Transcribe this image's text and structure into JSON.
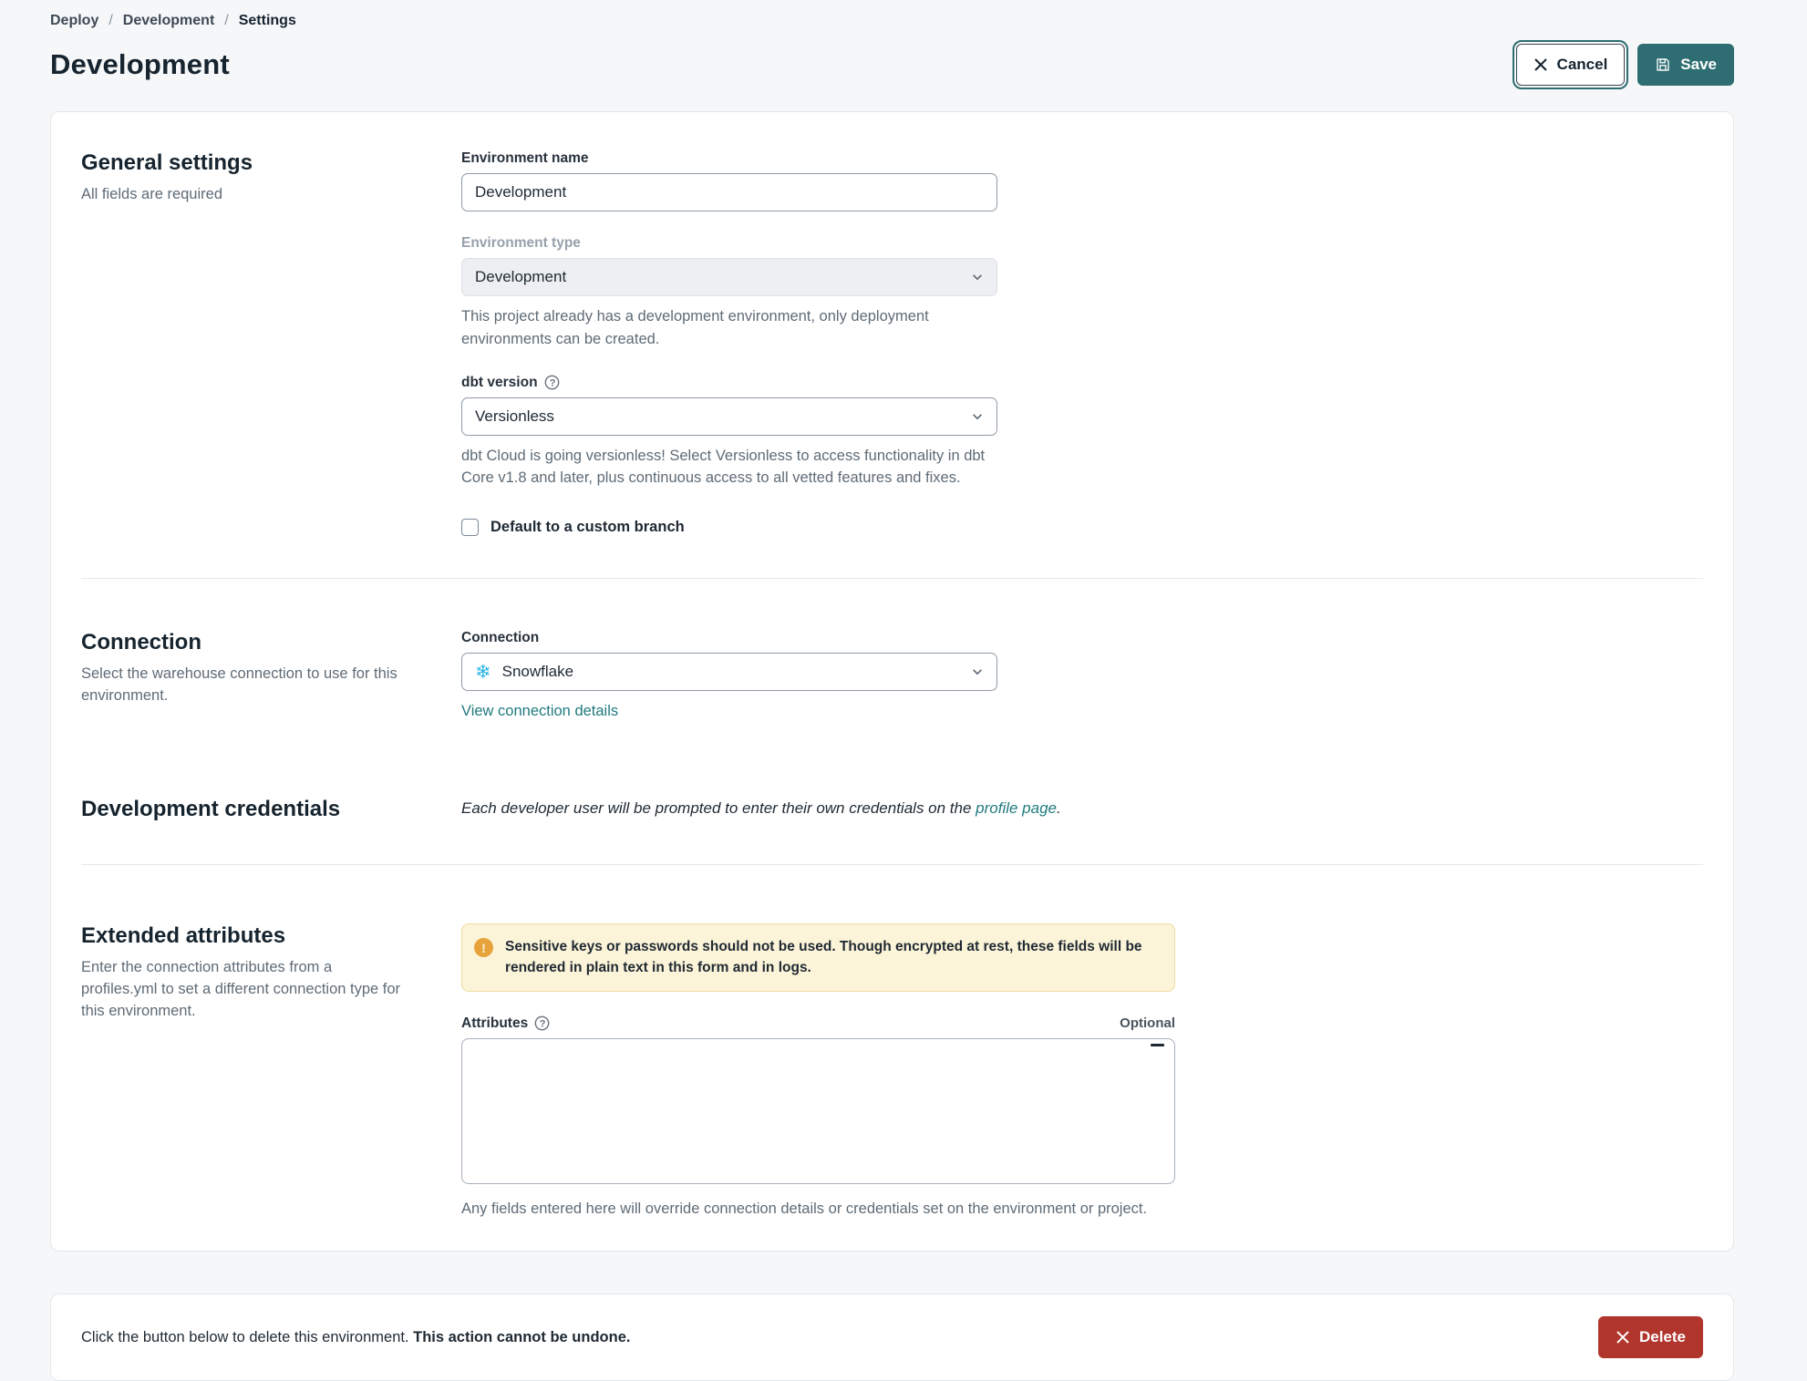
{
  "breadcrumb": {
    "items": [
      {
        "label": "Deploy"
      },
      {
        "label": "Development"
      },
      {
        "label": "Settings"
      }
    ],
    "separator": "/"
  },
  "header": {
    "title": "Development",
    "cancel_label": "Cancel",
    "save_label": "Save"
  },
  "general": {
    "heading": "General settings",
    "subheading": "All fields are required",
    "environment_name": {
      "label": "Environment name",
      "value": "Development"
    },
    "environment_type": {
      "label": "Environment type",
      "value": "Development",
      "help": "This project already has a development environment, only deployment environments can be created."
    },
    "dbt_version": {
      "label": "dbt version",
      "value": "Versionless",
      "help": "dbt Cloud is going versionless! Select Versionless to access functionality in dbt Core v1.8 and later, plus continuous access to all vetted features and fixes."
    },
    "custom_branch": {
      "label": "Default to a custom branch",
      "checked": false
    }
  },
  "connection": {
    "heading": "Connection",
    "subheading": "Select the warehouse connection to use for this environment.",
    "field_label": "Connection",
    "value": "Snowflake",
    "icon": "snowflake-logo",
    "link": "View connection details"
  },
  "credentials": {
    "heading": "Development credentials",
    "note_prefix": "Each developer user will be prompted to enter their own credentials on the ",
    "note_link": "profile page",
    "note_suffix": "."
  },
  "extended": {
    "heading": "Extended attributes",
    "subheading": "Enter the connection attributes from a profiles.yml to set a different connection type for this environment.",
    "warning": "Sensitive keys or passwords should not be used. Though encrypted at rest, these fields will be rendered in plain text in this form and in logs.",
    "attributes_label": "Attributes",
    "optional_label": "Optional",
    "help": "Any fields entered here will override connection details or credentials set on the environment or project."
  },
  "danger": {
    "text_prefix": "Click the button below to delete this environment. ",
    "text_bold": "This action cannot be undone.",
    "delete_label": "Delete"
  },
  "colors": {
    "teal": "#2e6d71",
    "link_teal": "#217a7e",
    "delete_red": "#b0352c",
    "snowflake_blue": "#29b5e8",
    "warning_bg": "#fcf4d8",
    "warning_icon": "#e7a33b"
  }
}
